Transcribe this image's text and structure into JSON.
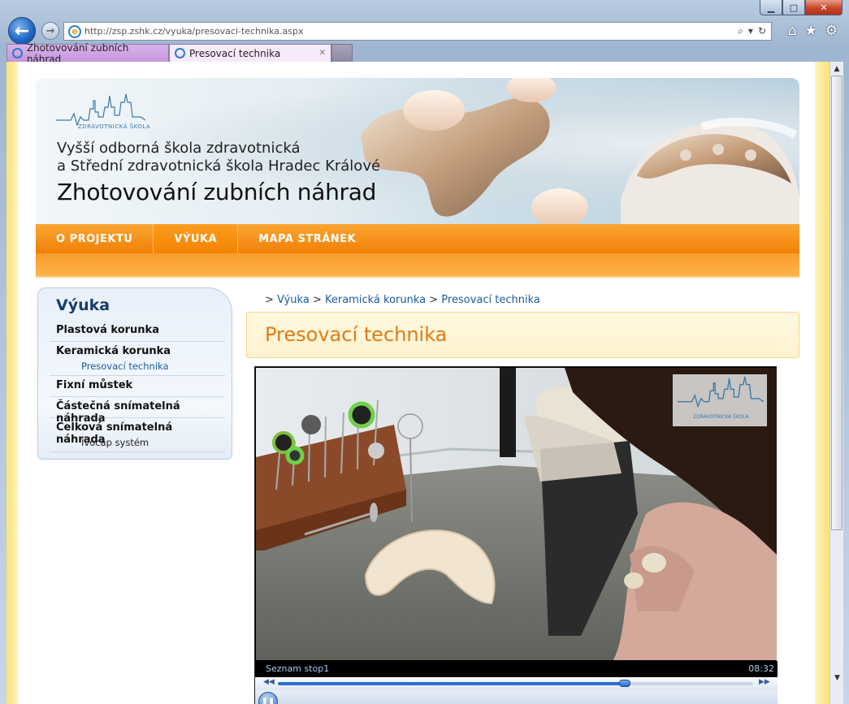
{
  "browser": {
    "url": "http://zsp.zshk.cz/vyuka/presovaci-technika.aspx",
    "tabs": [
      {
        "label": "Zhotovování zubních náhrad"
      },
      {
        "label": "Presovací technika"
      }
    ],
    "tab_close": "✕"
  },
  "banner": {
    "logo_text": "ZDRAVOTNICKÁ ŠKOLA",
    "school_line1": "Vyšší odborná škola zdravotnická",
    "school_line2": "a Střední zdravotnická škola Hradec Králové",
    "title": "Zhotovování zubních náhrad"
  },
  "menu": {
    "items": [
      {
        "label": "O PROJEKTU"
      },
      {
        "label": "VÝUKA"
      },
      {
        "label": "MAPA STRÁNEK"
      }
    ],
    "active": "VÝUKA"
  },
  "sidebar": {
    "title": "Výuka",
    "items": [
      {
        "label": "Plastová korunka"
      },
      {
        "label": "Keramická korunka"
      },
      {
        "label": "Presovací technika"
      },
      {
        "label": "Fixní můstek"
      },
      {
        "label": "Částečná snímatelná náhrada"
      },
      {
        "label": "Celková snímatelná náhrada"
      },
      {
        "label": "Ivocap systém"
      }
    ]
  },
  "breadcrumb": {
    "sep": ">",
    "items": [
      {
        "label": "Výuka"
      },
      {
        "label": "Keramická korunka"
      },
      {
        "label": "Presovací technika"
      }
    ]
  },
  "content": {
    "title": "Presovací technika"
  },
  "video": {
    "title": "Seznam stop1",
    "time": "08:32",
    "watermark": "ZDRAVOTNICKÁ ŠKOLA",
    "progress": 0.73
  },
  "colors": {
    "accent_orange": "#f08006",
    "title_orange": "#e07b16",
    "link_blue": "#1b5aa0"
  }
}
